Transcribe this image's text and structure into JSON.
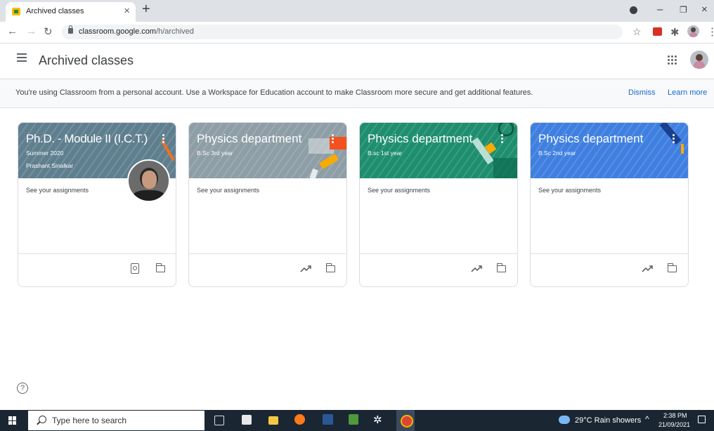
{
  "browser": {
    "tab_title": "Archived classes",
    "tab_close": "×",
    "new_tab": "+",
    "url_host": "classroom.google.com",
    "url_path": "/h/archived",
    "window_controls": [
      "–",
      "❐",
      "×"
    ]
  },
  "header": {
    "title": "Archived classes"
  },
  "banner": {
    "text": "You're using Classroom from a personal account. Use a Workspace for Education account to make Classroom more secure and get additional features.",
    "dismiss": "Dismiss",
    "learn_more": "Learn more"
  },
  "cards": [
    {
      "title": "Ph.D. - Module II (I.C.T.)",
      "section": "Summer 2020",
      "teacher": "Prashant Sinalkar",
      "link": "See your assignments",
      "color": "#5f7f8f",
      "actions": [
        "assignment-icon",
        "folder-icon"
      ]
    },
    {
      "title": "Physics department",
      "section": "B.Sc 3rd year",
      "link": "See your assignments",
      "color": "#8e9ea6",
      "actions": [
        "trending-icon",
        "folder-icon"
      ]
    },
    {
      "title": "Physics department",
      "section": "B.sc 1st year",
      "link": "See your assignments",
      "color": "#1e8e6e",
      "actions": [
        "trending-icon",
        "folder-icon"
      ]
    },
    {
      "title": "Physics department",
      "section": "B.Sc 2nd year",
      "link": "See your assignments",
      "color": "#3f7fe0",
      "actions": [
        "trending-icon",
        "folder-icon"
      ]
    }
  ],
  "help": "?",
  "taskbar": {
    "search_placeholder": "Type here to search",
    "weather": "29°C  Rain showers",
    "time": "2:38 PM",
    "date": "21/09/2021"
  }
}
